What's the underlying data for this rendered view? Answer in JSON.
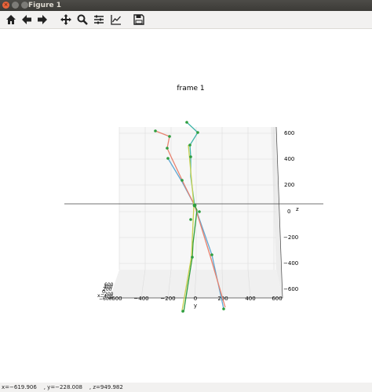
{
  "window": {
    "title": "Figure 1"
  },
  "toolbar": {
    "buttons": [
      {
        "name": "home",
        "icon": "home-icon"
      },
      {
        "name": "back",
        "icon": "arrow-left-icon"
      },
      {
        "name": "forward",
        "icon": "arrow-right-icon"
      },
      {
        "name": "pan",
        "icon": "move-icon"
      },
      {
        "name": "zoom",
        "icon": "magnifier-icon"
      },
      {
        "name": "configure-subplots",
        "icon": "sliders-icon"
      },
      {
        "name": "edit-axes",
        "icon": "line-chart-icon"
      },
      {
        "name": "save",
        "icon": "floppy-disk-icon"
      }
    ]
  },
  "plot": {
    "title": "frame 1",
    "x_label": "y",
    "z_label": "z",
    "y_axis_label": "x",
    "x_ticks": [
      "−600",
      "−400",
      "−200",
      "0",
      "200",
      "400",
      "600"
    ],
    "z_ticks": [
      "600",
      "400",
      "200",
      "0",
      "−200",
      "−400",
      "−600"
    ],
    "depth_ticks": [
      "−600",
      "−400",
      "−200",
      "0",
      "200",
      "400",
      "600"
    ],
    "colors": {
      "blue": "#5fa8d3",
      "red": "#e8826e",
      "green": "#2e9e3e",
      "yellow": "#c8d050",
      "teal": "#3fb5a8"
    }
  },
  "status": {
    "text": "x=−619.906    , y=−228.008    , z=949.982"
  }
}
